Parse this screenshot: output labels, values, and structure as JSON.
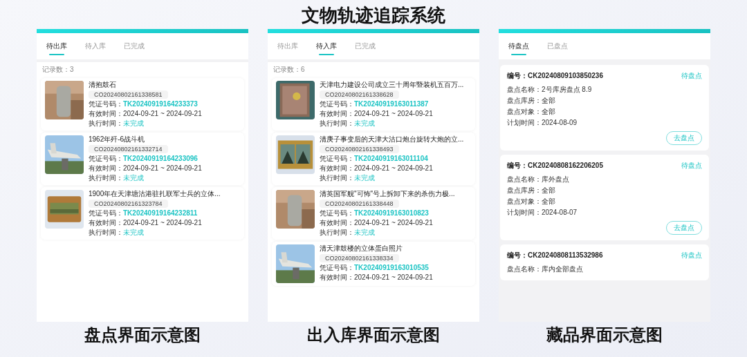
{
  "title": "文物轨迹追踪系统",
  "panels": [
    {
      "kind": "transfer",
      "caption": "盘点界面示意图",
      "tabs": [
        {
          "label": "待出库",
          "selected": true
        },
        {
          "label": "待入库",
          "selected": false
        },
        {
          "label": "已完成",
          "selected": false
        }
      ],
      "record_count": "记录数：3",
      "items": [
        {
          "image": {
            "kind": "picture"
          },
          "name": "清抱鼓石",
          "code": "CO20240802161338581",
          "fields": [
            {
              "label": "凭证号码：",
              "value": "TK20240919164233373",
              "kind": "accent"
            },
            {
              "label": "有效时间：",
              "value": "2024-09-21 ~ 2024-09-21",
              "kind": "plain"
            },
            {
              "label": "执行时间：",
              "value": "未完成",
              "kind": "status"
            }
          ]
        },
        {
          "image": {
            "kind": "picture"
          },
          "name": "1962年歼-6战斗机",
          "code": "CO20240802161332714",
          "fields": [
            {
              "label": "凭证号码：",
              "value": "TK20240919164233096",
              "kind": "accent"
            },
            {
              "label": "有效时间：",
              "value": "2024-09-21 ~ 2024-09-21",
              "kind": "plain"
            },
            {
              "label": "执行时间：",
              "value": "未完成",
              "kind": "status"
            }
          ]
        },
        {
          "image": {
            "kind": "picture"
          },
          "name": "1900年在天津塘沽港驻扎联军士兵的立体...",
          "code": "CO20240802161323784",
          "fields": [
            {
              "label": "凭证号码：",
              "value": "TK20240919164232811",
              "kind": "accent"
            },
            {
              "label": "有效时间：",
              "value": "2024-09-21 ~ 2024-09-21",
              "kind": "plain"
            },
            {
              "label": "执行时间：",
              "value": "未完成",
              "kind": "status"
            }
          ]
        }
      ]
    },
    {
      "kind": "transfer",
      "caption": "出入库界面示意图",
      "tabs": [
        {
          "label": "待出库",
          "selected": false
        },
        {
          "label": "待入库",
          "selected": true
        },
        {
          "label": "已完成",
          "selected": false
        }
      ],
      "record_count": "记录数：6",
      "items": [
        {
          "image": {
            "kind": "picture"
          },
          "name": "天津电力建设公司成立三十周年暨装机五百万...",
          "code": "CO20240802161338628",
          "fields": [
            {
              "label": "凭证号码：",
              "value": "TK20240919163011387",
              "kind": "accent"
            },
            {
              "label": "有效时间：",
              "value": "2024-09-21 ~ 2024-09-21",
              "kind": "plain"
            },
            {
              "label": "执行时间：",
              "value": "未完成",
              "kind": "status"
            }
          ]
        },
        {
          "image": {
            "kind": "picture"
          },
          "name": "清庚子事变后的天津大沽口炮台旋转大炮的立...",
          "code": "CO20240802161338493",
          "fields": [
            {
              "label": "凭证号码：",
              "value": "TK20240919163011104",
              "kind": "accent"
            },
            {
              "label": "有效时间：",
              "value": "2024-09-21 ~ 2024-09-21",
              "kind": "plain"
            },
            {
              "label": "执行时间：",
              "value": "未完成",
              "kind": "status"
            }
          ]
        },
        {
          "image": {
            "kind": "picture"
          },
          "name": "清英国军舰\"可怖\"号上拆卸下来的杀伤力极...",
          "code": "CO20240802161338448",
          "fields": [
            {
              "label": "凭证号码：",
              "value": "TK20240919163010823",
              "kind": "accent"
            },
            {
              "label": "有效时间：",
              "value": "2024-09-21 ~ 2024-09-21",
              "kind": "plain"
            },
            {
              "label": "执行时间：",
              "value": "未完成",
              "kind": "status"
            }
          ]
        },
        {
          "image": {
            "kind": "picture"
          },
          "name": "清天津鼓楼的立体蛋白照片",
          "code": "CO20240802161338334",
          "fields": [
            {
              "label": "凭证号码：",
              "value": "TK20240919163010535",
              "kind": "accent"
            },
            {
              "label": "有效时间：",
              "value": "2024-09-21 ~ 2024-09-21",
              "kind": "plain"
            }
          ]
        }
      ]
    },
    {
      "kind": "inventory",
      "caption": "藏品界面示意图",
      "tabs": [
        {
          "label": "待盘点",
          "selected": true
        },
        {
          "label": "已盘点",
          "selected": false
        }
      ],
      "items": [
        {
          "number": "编号：CK20240809103850236",
          "status": "待盘点",
          "fields": [
            {
              "label": "盘点名称：",
              "value": "2号库房盘点 8.9"
            },
            {
              "label": "盘点库房：",
              "value": "全部"
            },
            {
              "label": "盘点对象：",
              "value": "全部"
            },
            {
              "label": "计划时间：",
              "value": "2024-08-09"
            }
          ],
          "button": "去盘点"
        },
        {
          "number": "编号：CK20240808162206205",
          "status": "待盘点",
          "fields": [
            {
              "label": "盘点名称：",
              "value": "库外盘点"
            },
            {
              "label": "盘点库房：",
              "value": "全部"
            },
            {
              "label": "盘点对象：",
              "value": "全部"
            },
            {
              "label": "计划时间：",
              "value": "2024-08-07"
            }
          ],
          "button": "去盘点"
        },
        {
          "number": "编号：CK20240808113532986",
          "status": "待盘点",
          "fields": [
            {
              "label": "盘点名称：",
              "value": "库内全部盘点"
            }
          ]
        }
      ]
    }
  ]
}
